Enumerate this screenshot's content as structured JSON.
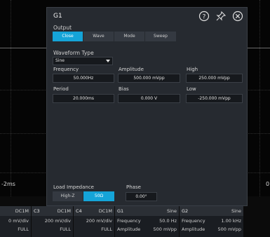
{
  "scope": {
    "time_label": "-2ms",
    "edge_label": "0"
  },
  "dialog": {
    "title": "G1",
    "icons": [
      "help-icon",
      "pin-icon",
      "close-icon"
    ],
    "output": {
      "label": "Output",
      "buttons": [
        "Close",
        "Wave",
        "Mode",
        "Sweep"
      ],
      "active": "Close"
    },
    "waveform_type": {
      "label": "Waveform Type",
      "value": "Sine"
    },
    "frequency": {
      "label": "Frequency",
      "value": "50.000Hz"
    },
    "amplitude": {
      "label": "Amplitude",
      "value": "500.000 mVpp"
    },
    "high": {
      "label": "High",
      "value": "250.000 mVpp"
    },
    "period": {
      "label": "Period",
      "value": "20.000ms"
    },
    "bias": {
      "label": "Bias",
      "value": "0.000 V"
    },
    "low": {
      "label": "Low",
      "value": "-250.000 mVpp"
    },
    "load_impedance": {
      "label": "Load Impedance",
      "buttons": [
        "High-Z",
        "50Ω"
      ],
      "active": "50Ω"
    },
    "phase": {
      "label": "Phase",
      "value": "0.00°"
    }
  },
  "channels": [
    {
      "name": "",
      "coupling": "DC1M",
      "scale": "0 mV/div",
      "bw": "FULL"
    },
    {
      "name": "C3",
      "coupling": "DC1M",
      "scale": "200 mV/div",
      "bw": "FULL"
    },
    {
      "name": "C4",
      "coupling": "DC1M",
      "scale": "200 mV/div",
      "bw": "FULL"
    }
  ],
  "generators": [
    {
      "name": "G1",
      "wave": "Sine",
      "freq_label": "Frequency",
      "freq": "50.0  Hz",
      "amp_label": "Amplitude",
      "amp": "500 mVpp"
    },
    {
      "name": "G2",
      "wave": "Sine",
      "freq_label": "Frequency",
      "freq": "1.00 kHz",
      "amp_label": "Amplitude",
      "amp": "500 mVpp"
    }
  ],
  "colors": {
    "accent": "#15a4d8",
    "dialog_bg": "#262a30",
    "field_bg": "#16191d"
  }
}
